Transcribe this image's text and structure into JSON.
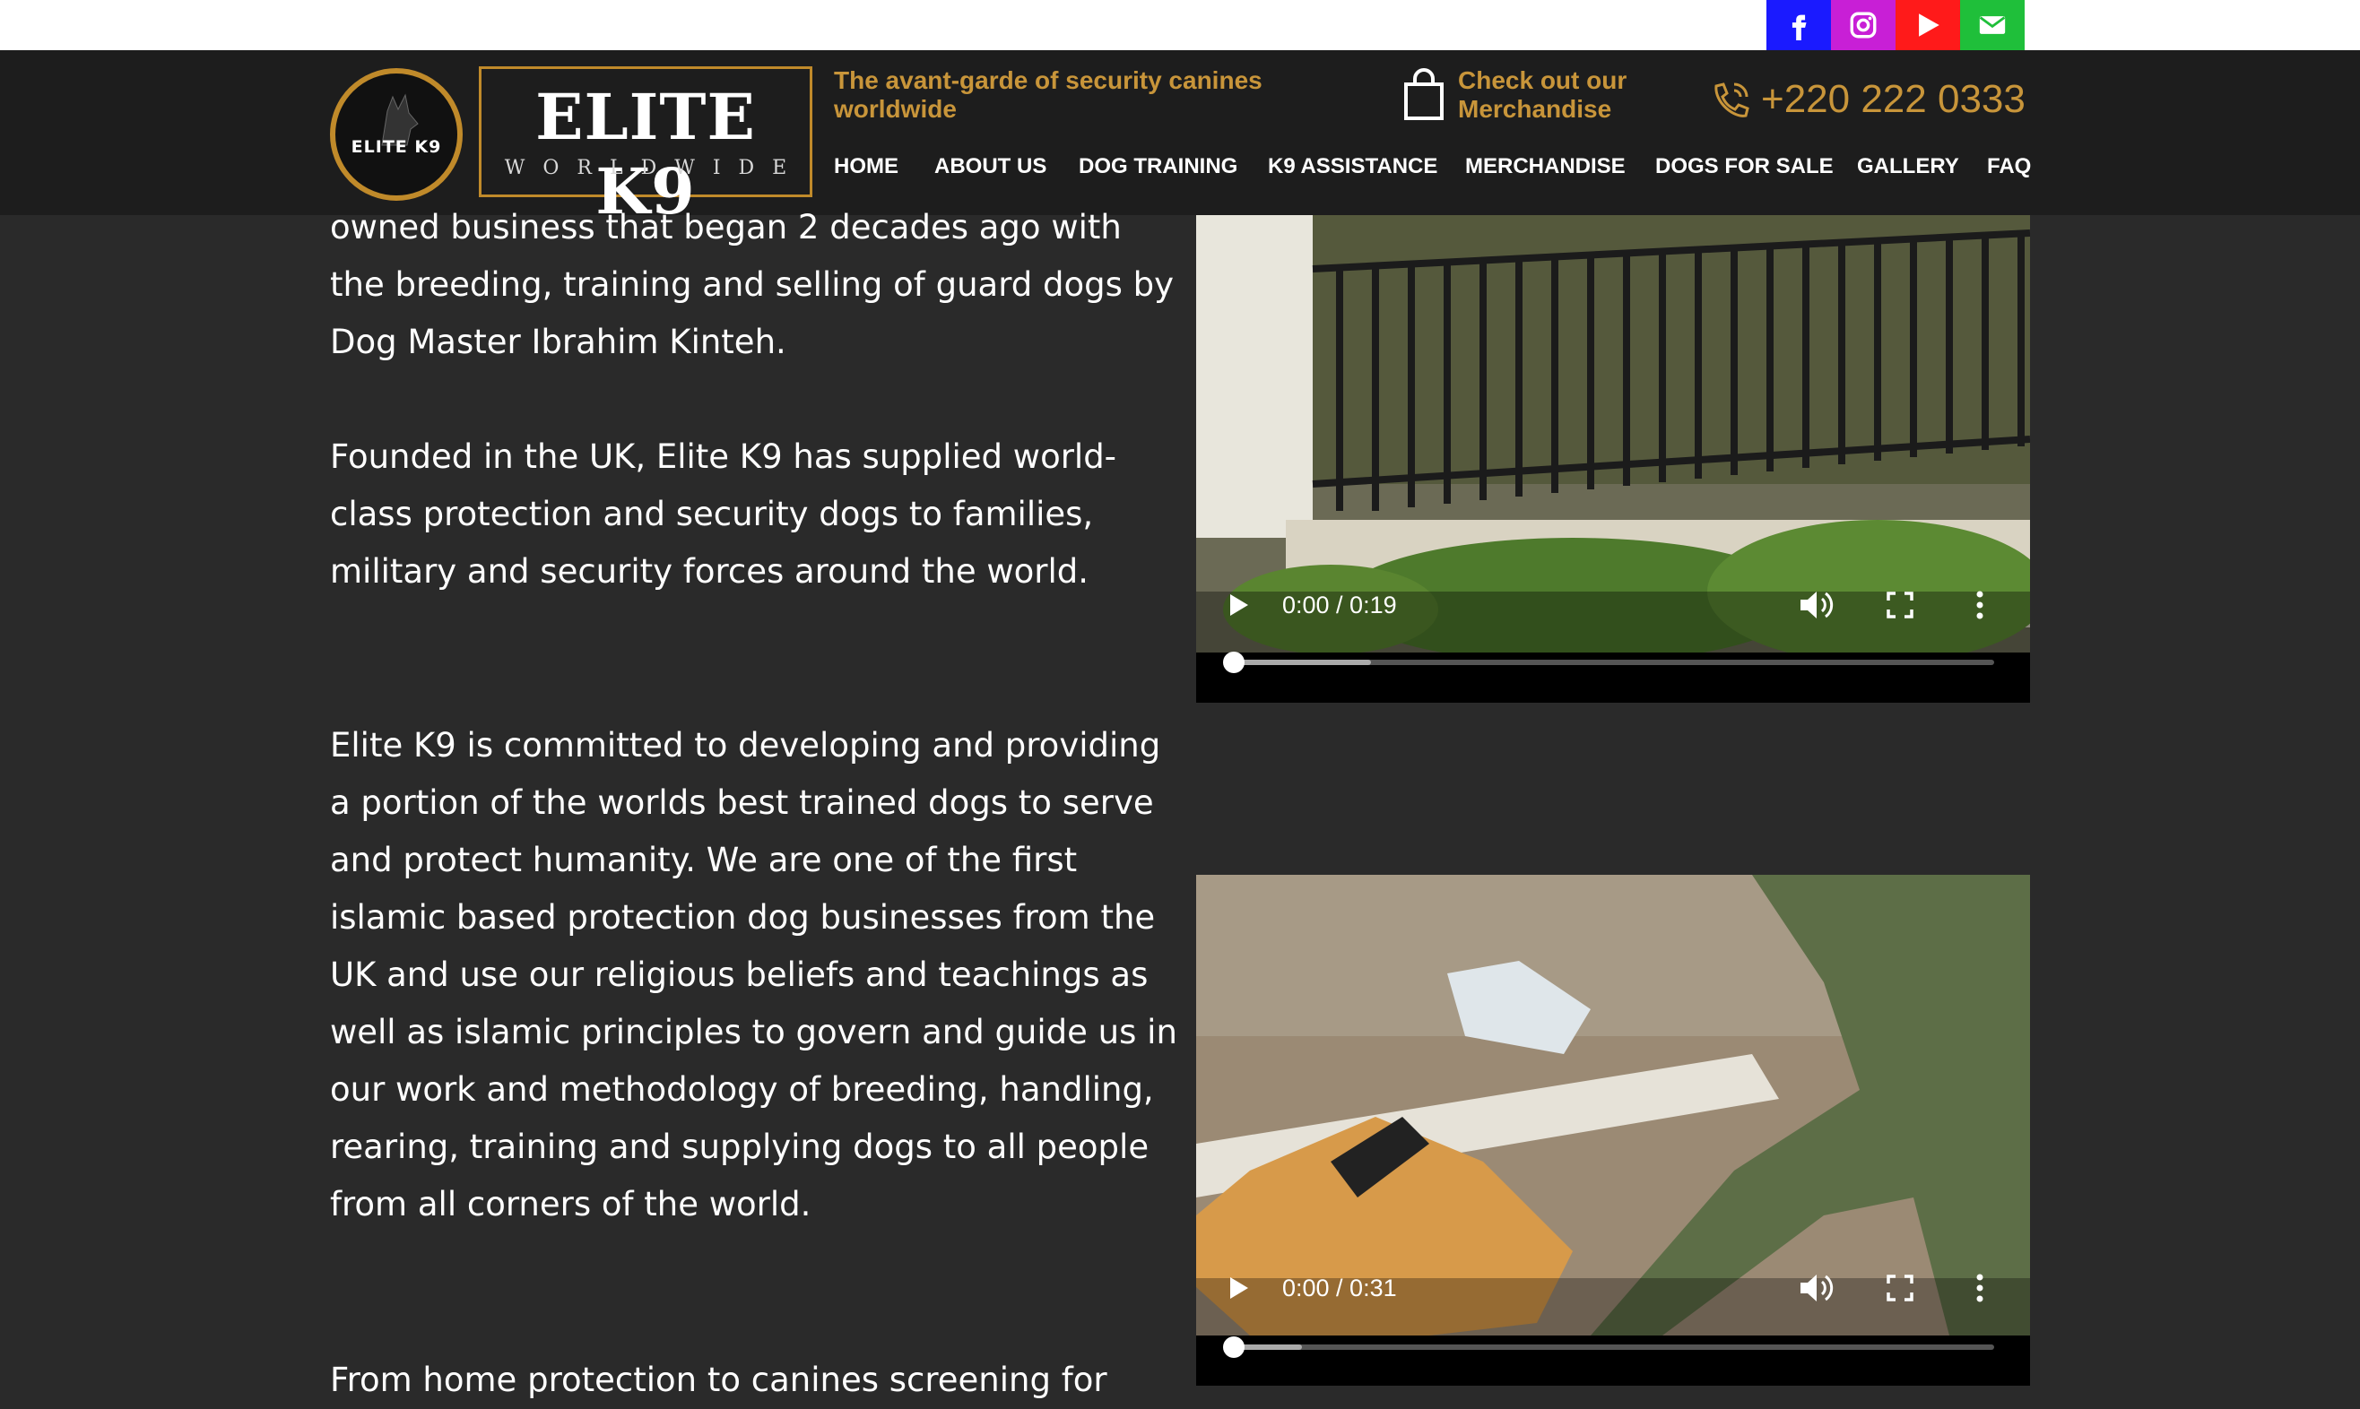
{
  "social": {
    "facebook_icon": "facebook-icon",
    "instagram_icon": "instagram-icon",
    "youtube_icon": "youtube-icon",
    "email_icon": "email-icon"
  },
  "header": {
    "logo_circle_text": "ELITE K9",
    "brand": "ELITE K9",
    "brand_sub": "WORLDWIDE",
    "tagline": "The avant-garde of security canines worldwide",
    "merch_line1": "Check out our",
    "merch_line2": "Merchandise",
    "phone": "+220 222 0333"
  },
  "nav": [
    {
      "label": "HOME"
    },
    {
      "label": "ABOUT US"
    },
    {
      "label": "DOG TRAINING"
    },
    {
      "label": "K9 ASSISTANCE"
    },
    {
      "label": "MERCHANDISE"
    },
    {
      "label": "DOGS FOR SALE"
    },
    {
      "label": "GALLERY"
    },
    {
      "label": "FAQ"
    }
  ],
  "content": {
    "p1": [
      "owned business that began 2 decades ago with",
      "the breeding, training and selling of guard dogs by",
      "Dog Master Ibrahim Kinteh."
    ],
    "p2": [
      "Founded in the UK, Elite K9 has supplied world-",
      "class protection and security dogs to families,",
      "military and security forces around the world."
    ],
    "p3": [
      "Elite K9 is committed to developing and providing",
      "a portion of the worlds best trained dogs to serve",
      "and protect humanity. We are one of the first",
      "islamic based protection dog businesses from the",
      "UK and use our religious beliefs and teachings as",
      "well as islamic principles to govern and guide us in",
      "our work and methodology of breeding, handling,",
      "rearing, training and supplying dogs to all people",
      "from all corners of the world."
    ],
    "p4": [
      "From home protection to canines screening for"
    ]
  },
  "videos": [
    {
      "time": "0:00 / 0:19",
      "buffered": 0.18
    },
    {
      "time": "0:00 / 0:31",
      "buffered": 0.09
    }
  ],
  "colors": {
    "accent": "#c8953a",
    "header_bg": "#1d1d1d",
    "page_bg": "#2a2a2a"
  }
}
